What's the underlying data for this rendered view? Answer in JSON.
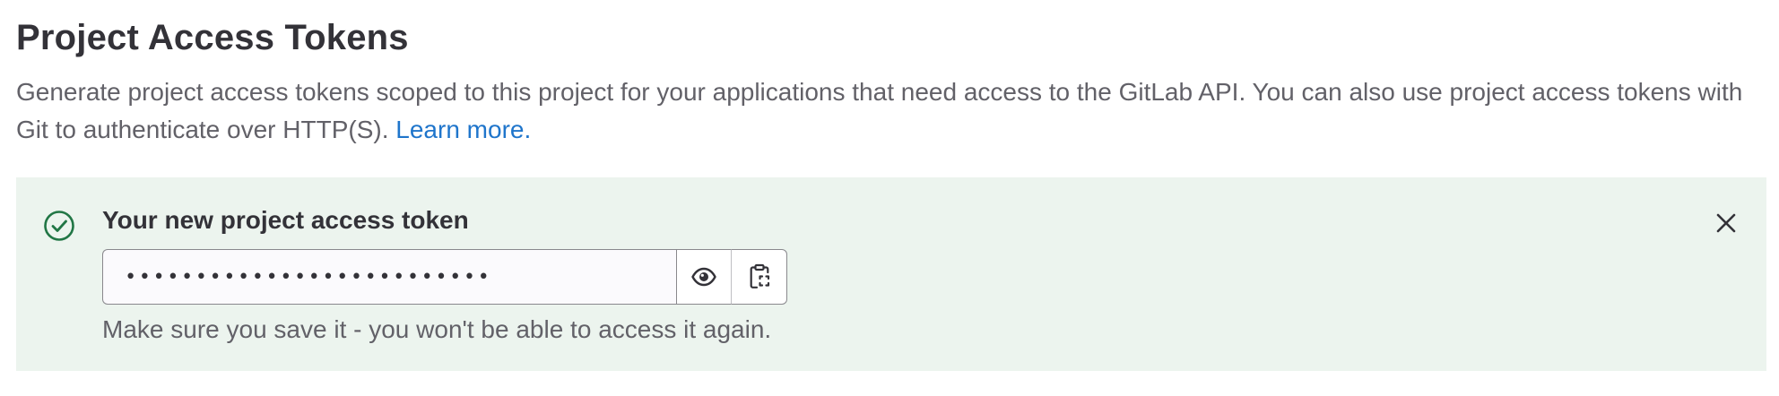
{
  "page": {
    "title": "Project Access Tokens",
    "description": "Generate project access tokens scoped to this project for your applications that need access to the GitLab API. You can also use project access tokens with Git to authenticate over HTTP(S).",
    "learn_more_label": "Learn more."
  },
  "alert": {
    "status": "success",
    "icon": "check-circle-icon",
    "title": "Your new project access token",
    "token_masked_value": "••••••••••••••••••••••••••",
    "reveal_icon": "eye-icon",
    "copy_icon": "copy-to-clipboard-icon",
    "helper_text": "Make sure you save it - you won't be able to access it again.",
    "close_icon": "close-icon"
  },
  "colors": {
    "alert_background": "#ecf4ee",
    "success_icon": "#217645",
    "link": "#1f75cb",
    "heading_text": "#333238",
    "secondary_text": "#626168"
  }
}
